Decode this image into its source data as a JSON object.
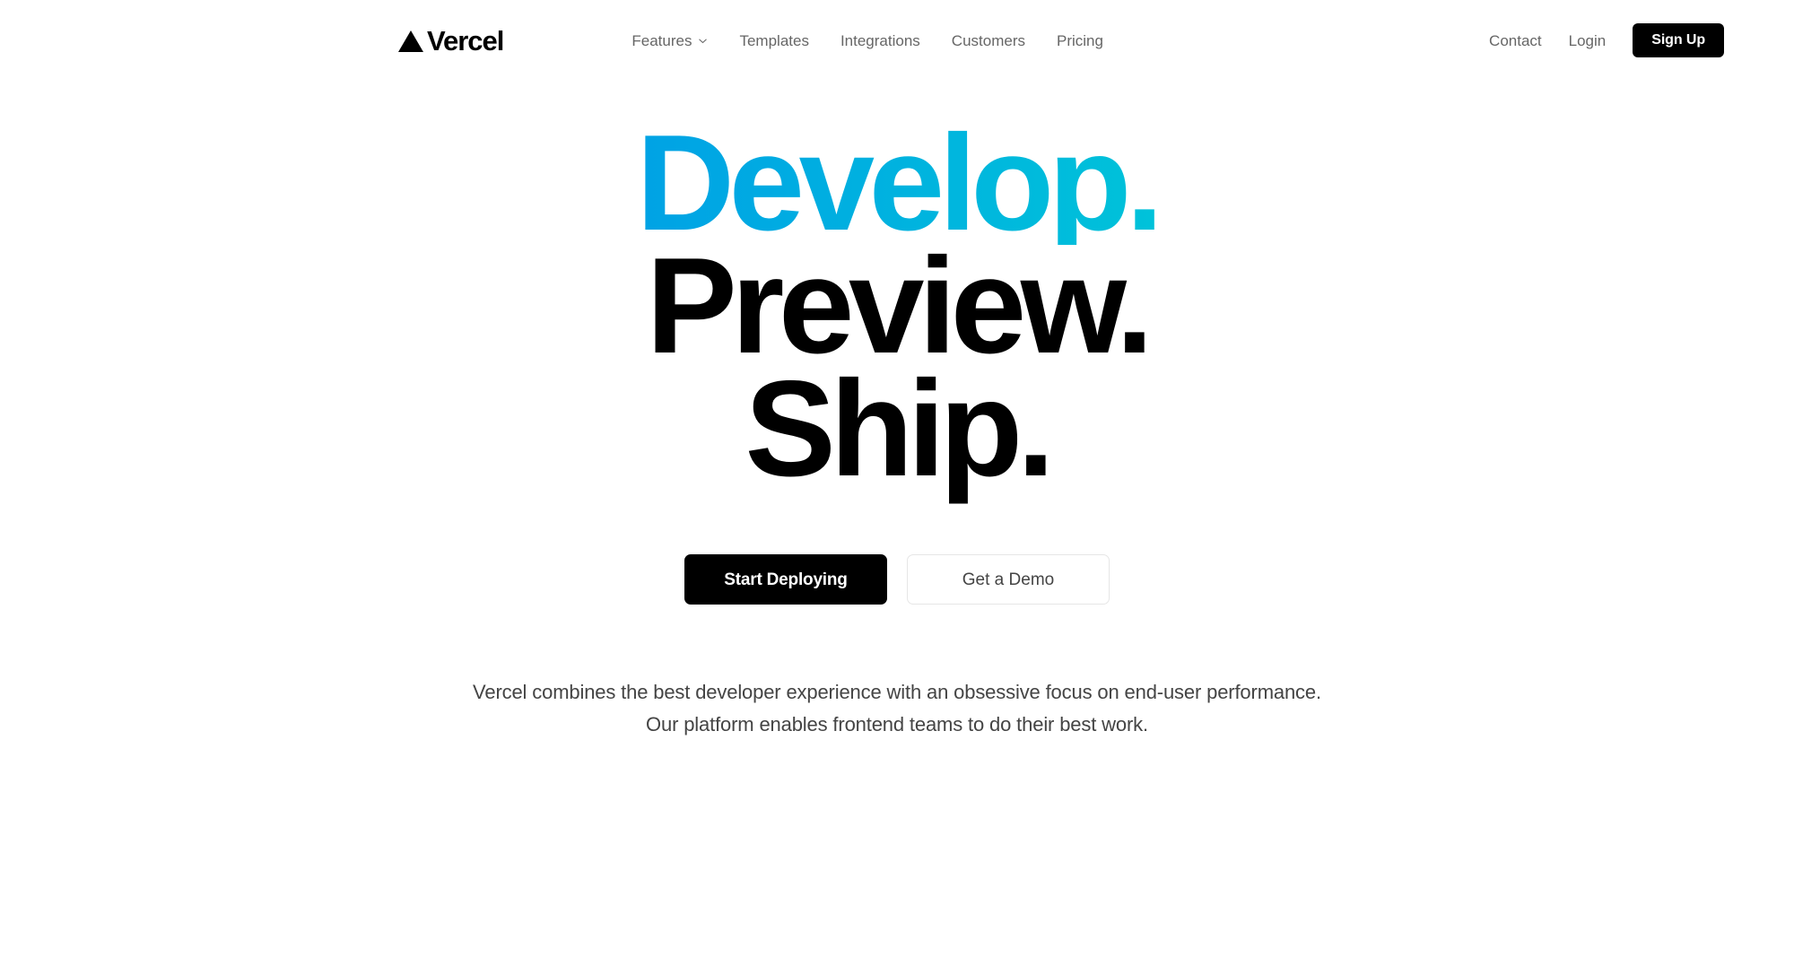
{
  "brand": {
    "name": "Vercel",
    "logo_icon": "vercel-triangle-icon"
  },
  "nav": {
    "links": [
      {
        "label": "Features",
        "has_dropdown": true,
        "icon": "chevron-down-icon"
      },
      {
        "label": "Templates",
        "has_dropdown": false
      },
      {
        "label": "Integrations",
        "has_dropdown": false
      },
      {
        "label": "Customers",
        "has_dropdown": false
      },
      {
        "label": "Pricing",
        "has_dropdown": false
      }
    ],
    "contact_label": "Contact",
    "login_label": "Login",
    "signup_label": "Sign Up"
  },
  "hero": {
    "headline_lines": [
      {
        "text": "Develop.",
        "style": "gradient"
      },
      {
        "text": "Preview.",
        "style": "black"
      },
      {
        "text": "Ship.",
        "style": "black"
      }
    ],
    "primary_cta": "Start Deploying",
    "secondary_cta": "Get a Demo",
    "lede_line_1": "Vercel combines the best developer experience with an obsessive focus on end-user performance.",
    "lede_line_2": "Our platform enables frontend teams to do their best work."
  },
  "colors": {
    "page_background": "#ffffff",
    "text_primary": "#000000",
    "text_muted": "#666666",
    "lede_text": "#444444",
    "button_dark": "#000000",
    "button_border": "#e6e6e6",
    "gradient_start": "#007cf0",
    "gradient_mid": "#00a5e4",
    "gradient_end": "#16d5dd"
  }
}
